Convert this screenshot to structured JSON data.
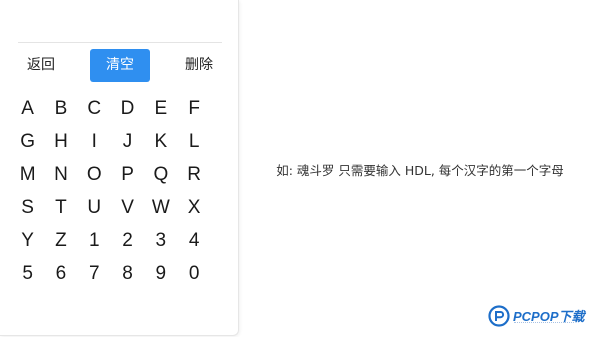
{
  "actions": {
    "back_label": "返回",
    "clear_label": "清空",
    "delete_label": "删除"
  },
  "keyboard": {
    "keys": [
      "A",
      "B",
      "C",
      "D",
      "E",
      "F",
      "G",
      "H",
      "I",
      "J",
      "K",
      "L",
      "M",
      "N",
      "O",
      "P",
      "Q",
      "R",
      "S",
      "T",
      "U",
      "V",
      "W",
      "X",
      "Y",
      "Z",
      "1",
      "2",
      "3",
      "4",
      "5",
      "6",
      "7",
      "8",
      "9",
      "0"
    ]
  },
  "hint": {
    "text": "如: 魂斗罗 只需要输入 HDL, 每个汉字的第一个字母"
  },
  "watermark": {
    "text": "PCPOP下载"
  },
  "colors": {
    "accent": "#2f8ff0",
    "watermark": "#1d6ec9"
  }
}
